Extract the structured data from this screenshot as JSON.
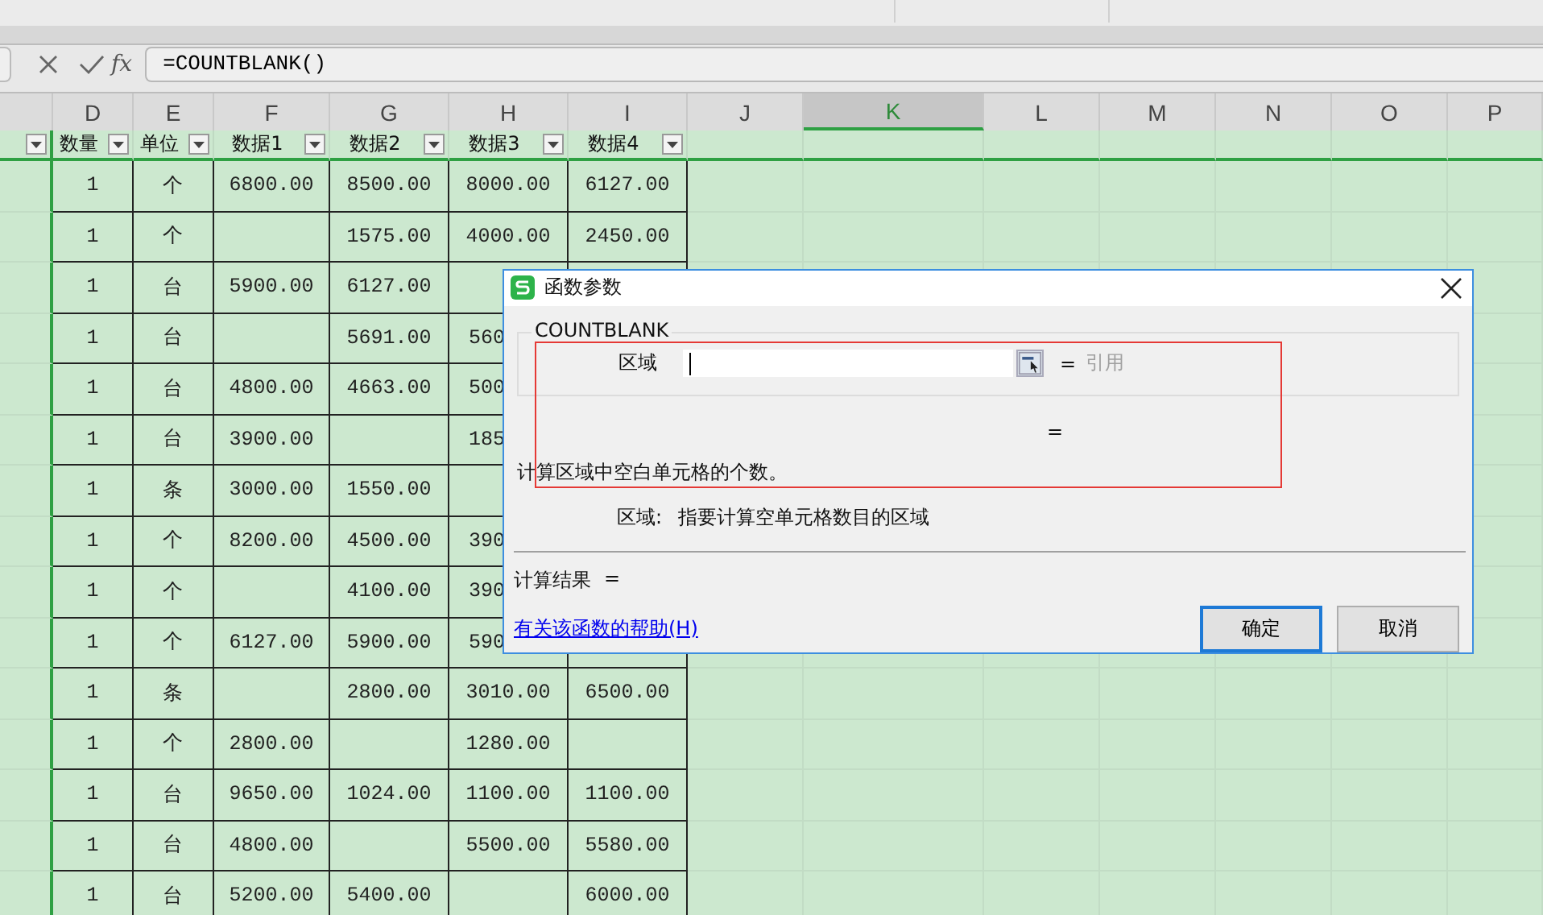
{
  "formula_bar": {
    "fx_label": "fx",
    "value": "=COUNTBLANK()"
  },
  "columns": [
    {
      "letter": "D",
      "selected": false
    },
    {
      "letter": "E",
      "selected": false
    },
    {
      "letter": "F",
      "selected": false
    },
    {
      "letter": "G",
      "selected": false
    },
    {
      "letter": "H",
      "selected": false
    },
    {
      "letter": "I",
      "selected": false
    },
    {
      "letter": "J",
      "selected": false
    },
    {
      "letter": "K",
      "selected": true
    },
    {
      "letter": "L",
      "selected": false
    },
    {
      "letter": "M",
      "selected": false
    },
    {
      "letter": "N",
      "selected": false
    },
    {
      "letter": "O",
      "selected": false
    },
    {
      "letter": "P",
      "selected": false
    }
  ],
  "filter_headers": [
    "数量",
    "单位",
    "数据1",
    "数据2",
    "数据3",
    "数据4"
  ],
  "rows": [
    {
      "cells": {
        "d": "1",
        "e": "个",
        "f": "6800.00",
        "g": "8500.00",
        "h": "8000.00",
        "i": "6127.00"
      }
    },
    {
      "cells": {
        "d": "1",
        "e": "个",
        "g": "1575.00",
        "h": "4000.00",
        "i": "2450.00"
      }
    },
    {
      "cells": {
        "d": "1",
        "e": "台",
        "f": "5900.00",
        "g": "6127.00"
      }
    },
    {
      "cells": {
        "d": "1",
        "e": "台",
        "g": "5691.00",
        "h": "560"
      }
    },
    {
      "cells": {
        "d": "1",
        "e": "台",
        "f": "4800.00",
        "g": "4663.00",
        "h": "500"
      }
    },
    {
      "cells": {
        "d": "1",
        "e": "台",
        "f": "3900.00",
        "h": "185"
      }
    },
    {
      "cells": {
        "d": "1",
        "e": "条",
        "f": "3000.00",
        "g": "1550.00"
      }
    },
    {
      "cells": {
        "d": "1",
        "e": "个",
        "f": "8200.00",
        "g": "4500.00",
        "h": "390"
      }
    },
    {
      "cells": {
        "d": "1",
        "e": "个",
        "g": "4100.00",
        "h": "390"
      }
    },
    {
      "cells": {
        "d": "1",
        "e": "个",
        "f": "6127.00",
        "g": "5900.00",
        "h": "590"
      }
    },
    {
      "cells": {
        "d": "1",
        "e": "条",
        "g": "2800.00",
        "h": "3010.00",
        "i": "6500.00"
      }
    },
    {
      "cells": {
        "d": "1",
        "e": "个",
        "f": "2800.00",
        "h": "1280.00"
      }
    },
    {
      "cells": {
        "d": "1",
        "e": "台",
        "f": "9650.00",
        "g": "1024.00",
        "h": "1100.00",
        "i": "1100.00"
      }
    },
    {
      "cells": {
        "d": "1",
        "e": "台",
        "f": "4800.00",
        "h": "5500.00",
        "i": "5580.00"
      }
    },
    {
      "cells": {
        "d": "1",
        "e": "台",
        "f": "5200.00",
        "g": "5400.00",
        "i": "6000.00"
      }
    }
  ],
  "dialog": {
    "title": "函数参数",
    "function_name": "COUNTBLANK",
    "argument": {
      "label": "区域",
      "result_eq": "=",
      "result_type": "引用"
    },
    "formula_result_eq": "=",
    "description": "计算区域中空白单元格的个数。",
    "argument_help": {
      "label": "区域:",
      "text": "指要计算空单元格数目的区域"
    },
    "result_label": "计算结果",
    "result_eq": "=",
    "help_link": "有关该函数的帮助(H)",
    "buttons": [
      {
        "label": "确定",
        "focused": true
      },
      {
        "label": "取消",
        "focused": false
      }
    ],
    "highlight_box": true
  }
}
